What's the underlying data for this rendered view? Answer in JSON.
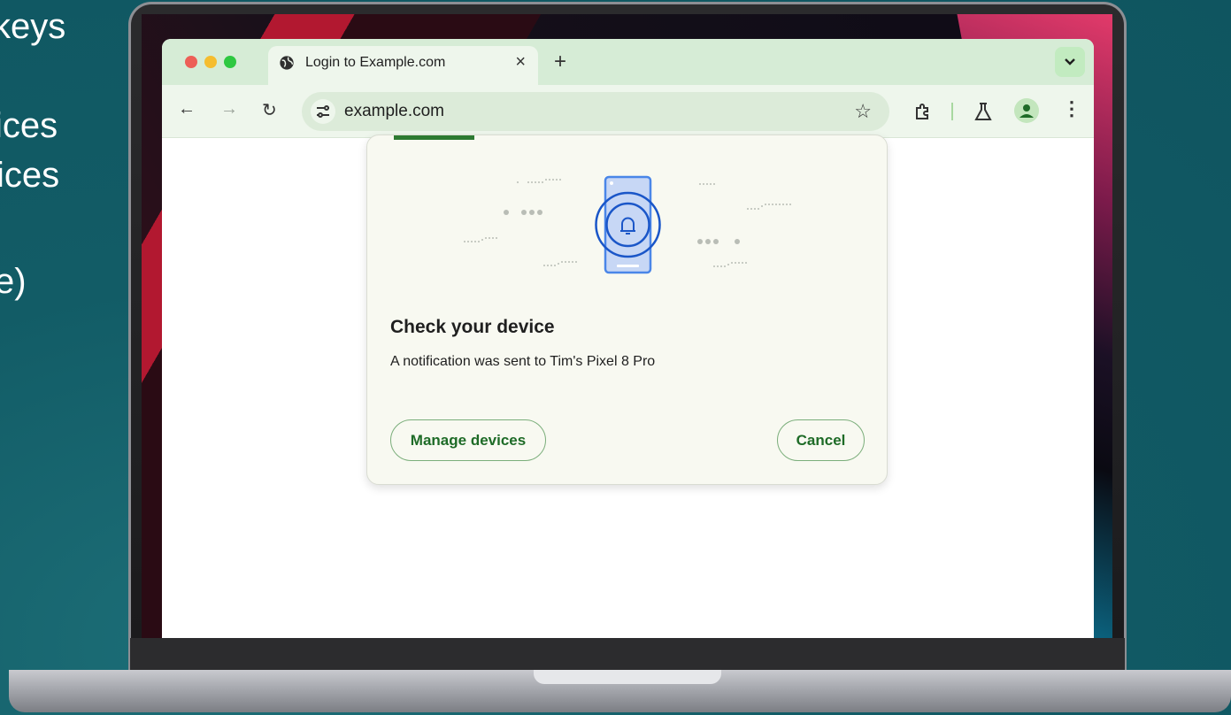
{
  "slide_text": [
    "keys",
    "ices",
    "ices",
    "e)"
  ],
  "browser": {
    "tab_title": "Login to Example.com",
    "tab_close": "×",
    "new_tab": "+",
    "url": "example.com",
    "nav": {
      "back": "←",
      "forward": "→",
      "reload": "↻"
    },
    "bookmark": "☆",
    "menu": "⋮"
  },
  "dialog": {
    "heading": "Check your device",
    "message": "A notification was sent to Tim's Pixel 8 Pro",
    "manage_label": "Manage devices",
    "cancel_label": "Cancel"
  },
  "colors": {
    "accent": "#1e6b27",
    "tabbar": "#d6ecd6",
    "phone_blue": "#1a56c8"
  },
  "icons": [
    "globe-icon",
    "close-icon",
    "plus-icon",
    "chevron-down-icon",
    "back-arrow-icon",
    "forward-arrow-icon",
    "reload-icon",
    "tune-icon",
    "star-icon",
    "extensions-icon",
    "labs-flask-icon",
    "profile-icon",
    "more-vert-icon",
    "phone-notification-icon"
  ]
}
